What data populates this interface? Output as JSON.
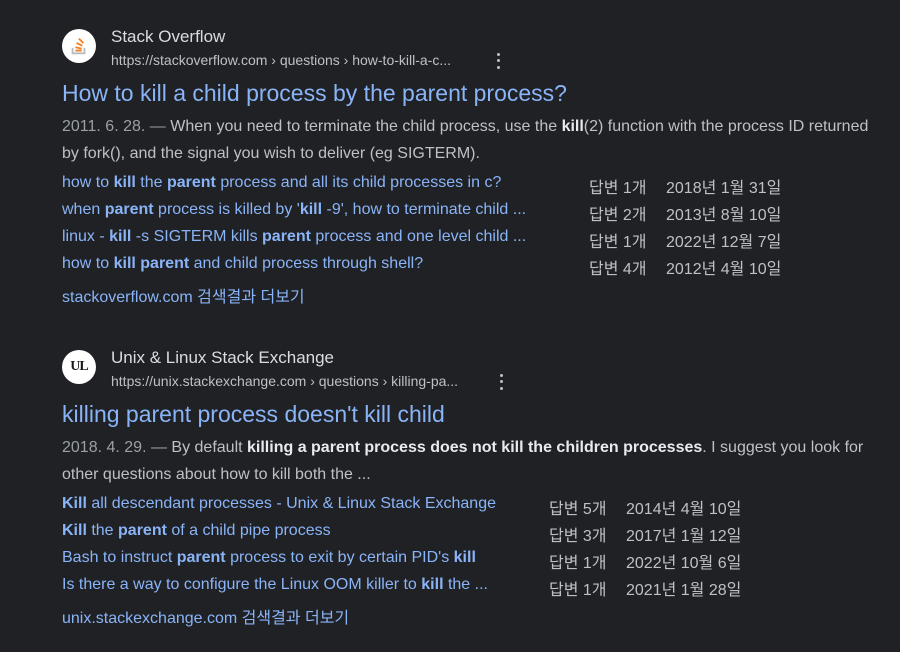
{
  "results": [
    {
      "site_name": "Stack Overflow",
      "url": "https://stackoverflow.com › questions › how-to-kill-a-c...",
      "favicon_icon": "stackoverflow-icon",
      "title": "How to kill a child process by the parent process?",
      "snippet": [
        {
          "t": "2011. 6. 28. — ",
          "s": "date"
        },
        {
          "t": "When you need to terminate the child process, use the ",
          "s": "n"
        },
        {
          "t": "kill",
          "s": "b"
        },
        {
          "t": "(2) function with the process ID returned by fork(), and the signal you wish to deliver (eg SIGTERM).",
          "s": "n"
        }
      ],
      "sub_results": [
        {
          "parts": [
            {
              "t": "how to ",
              "b": false
            },
            {
              "t": "kill",
              "b": true
            },
            {
              "t": " the ",
              "b": false
            },
            {
              "t": "parent",
              "b": true
            },
            {
              "t": " process and all its child processes in c?",
              "b": false
            }
          ],
          "answers": "답변 1개",
          "date": "2018년 1월 31일"
        },
        {
          "parts": [
            {
              "t": "when ",
              "b": false
            },
            {
              "t": "parent",
              "b": true
            },
            {
              "t": " process is killed by '",
              "b": false
            },
            {
              "t": "kill",
              "b": true
            },
            {
              "t": " -9', how to terminate child ...",
              "b": false
            }
          ],
          "answers": "답변 2개",
          "date": "2013년 8월 10일"
        },
        {
          "parts": [
            {
              "t": "linux - ",
              "b": false
            },
            {
              "t": "kill",
              "b": true
            },
            {
              "t": " -s SIGTERM kills ",
              "b": false
            },
            {
              "t": "parent",
              "b": true
            },
            {
              "t": " process and one level child ...",
              "b": false
            }
          ],
          "answers": "답변 1개",
          "date": "2022년 12월 7일"
        },
        {
          "parts": [
            {
              "t": "how to ",
              "b": false
            },
            {
              "t": "kill parent",
              "b": true
            },
            {
              "t": " and child process through shell?",
              "b": false
            }
          ],
          "answers": "답변 4개",
          "date": "2012년 4월 10일"
        }
      ],
      "more_link": "stackoverflow.com 검색결과 더보기"
    },
    {
      "site_name": "Unix & Linux Stack Exchange",
      "url": "https://unix.stackexchange.com › questions › killing-pa...",
      "favicon_icon": "unix-linux-icon",
      "favicon_text": "UL",
      "title": "killing parent process doesn't kill child",
      "snippet": [
        {
          "t": "2018. 4. 29. — ",
          "s": "date"
        },
        {
          "t": "By default ",
          "s": "n"
        },
        {
          "t": "killing a parent process does not kill the children processes",
          "s": "b"
        },
        {
          "t": ". I suggest you look for other questions about how to kill both the ...",
          "s": "n"
        }
      ],
      "sub_results": [
        {
          "parts": [
            {
              "t": "Kill",
              "b": true
            },
            {
              "t": " all descendant processes - Unix & Linux Stack Exchange",
              "b": false
            }
          ],
          "answers": "답변 5개",
          "date": "2014년 4월 10일"
        },
        {
          "parts": [
            {
              "t": "Kill",
              "b": true
            },
            {
              "t": " the ",
              "b": false
            },
            {
              "t": "parent",
              "b": true
            },
            {
              "t": " of a child pipe process",
              "b": false
            }
          ],
          "answers": "답변 3개",
          "date": "2017년 1월 12일"
        },
        {
          "parts": [
            {
              "t": "Bash to instruct ",
              "b": false
            },
            {
              "t": "parent",
              "b": true
            },
            {
              "t": " process to exit by certain PID's ",
              "b": false
            },
            {
              "t": "kill",
              "b": true
            }
          ],
          "answers": "답변 1개",
          "date": "2022년 10월 6일"
        },
        {
          "parts": [
            {
              "t": "Is there a way to configure the Linux OOM killer to ",
              "b": false
            },
            {
              "t": "kill",
              "b": true
            },
            {
              "t": " the ...",
              "b": false
            }
          ],
          "answers": "답변 1개",
          "date": "2021년 1월 28일"
        }
      ],
      "more_link": "unix.stackexchange.com 검색결과 더보기"
    }
  ],
  "colors": {
    "background": "#202124",
    "link": "#8ab4f8",
    "text": "#bdc1c6",
    "heading": "#dadce0",
    "so_orange": "#f48024"
  }
}
